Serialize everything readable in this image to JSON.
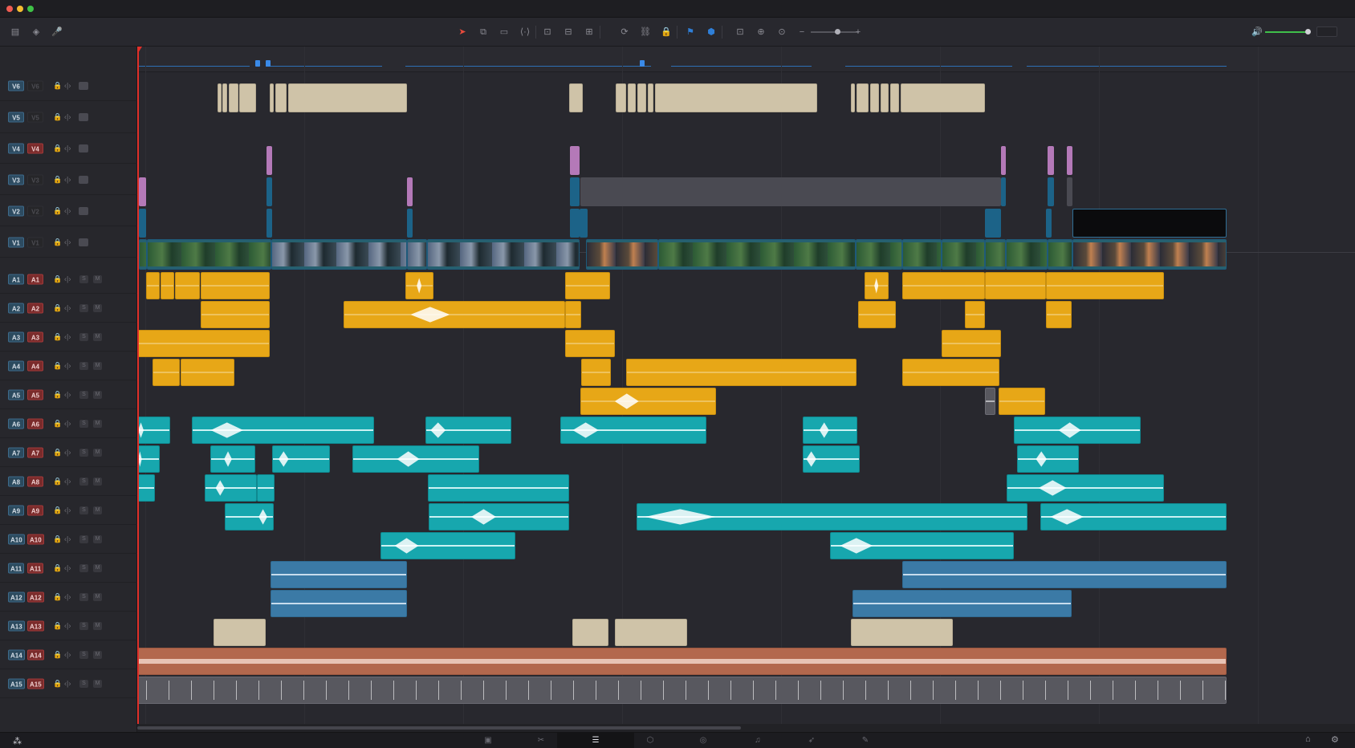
{
  "window": {
    "controls": [
      "close",
      "minimize",
      "maximize"
    ]
  },
  "toolbar": {
    "left_icons": [
      "layout-icon",
      "blade-edit-icon",
      "microphone-icon"
    ],
    "edit_tools": [
      {
        "name": "selection-tool-icon",
        "glyph": "➤",
        "active": true
      },
      {
        "name": "trim-tool-icon",
        "glyph": "⧉"
      },
      {
        "name": "blade-tool-icon",
        "glyph": "▭"
      },
      {
        "name": "dynamic-trim-icon",
        "glyph": "⟨·⟩"
      }
    ],
    "clip_tools": [
      {
        "name": "insert-clip-icon",
        "glyph": "⊡"
      },
      {
        "name": "overwrite-clip-icon",
        "glyph": "⊟"
      },
      {
        "name": "replace-clip-icon",
        "glyph": "⊞"
      }
    ],
    "link_tools": [
      {
        "name": "snapping-icon",
        "glyph": "⟳"
      },
      {
        "name": "linked-selection-icon",
        "glyph": "⛓"
      },
      {
        "name": "position-lock-icon",
        "glyph": "🔒"
      }
    ],
    "flag_tools": [
      {
        "name": "flag-icon",
        "glyph": "⚑"
      },
      {
        "name": "marker-icon",
        "glyph": "⬢"
      }
    ],
    "zoom_tools": [
      {
        "name": "full-extent-zoom-icon",
        "glyph": "⊡"
      },
      {
        "name": "detail-zoom-icon",
        "glyph": "⊕"
      },
      {
        "name": "custom-zoom-icon",
        "glyph": "⊙"
      }
    ],
    "zoom_minus": "−",
    "zoom_plus": "+",
    "zoom_level": 0.55,
    "volume_level": 0.9,
    "speaker_glyph": "🔊"
  },
  "video_tracks": [
    {
      "id": "V6",
      "dest": "V6",
      "dest_on": false
    },
    {
      "id": "V5",
      "dest": "V5",
      "dest_on": false
    },
    {
      "id": "V4",
      "dest": "V4",
      "dest_on": true
    },
    {
      "id": "V3",
      "dest": "V3",
      "dest_on": false
    },
    {
      "id": "V2",
      "dest": "V2",
      "dest_on": false
    },
    {
      "id": "V1",
      "dest": "V1",
      "dest_on": false
    }
  ],
  "audio_tracks": [
    {
      "id": "A1",
      "dest": "A1"
    },
    {
      "id": "A2",
      "dest": "A2"
    },
    {
      "id": "A3",
      "dest": "A3"
    },
    {
      "id": "A4",
      "dest": "A4"
    },
    {
      "id": "A5",
      "dest": "A5"
    },
    {
      "id": "A6",
      "dest": "A6"
    },
    {
      "id": "A7",
      "dest": "A7"
    },
    {
      "id": "A8",
      "dest": "A8"
    },
    {
      "id": "A9",
      "dest": "A9"
    },
    {
      "id": "A10",
      "dest": "A10"
    },
    {
      "id": "A11",
      "dest": "A11"
    },
    {
      "id": "A12",
      "dest": "A12"
    },
    {
      "id": "A13",
      "dest": "A13"
    },
    {
      "id": "A14",
      "dest": "A14"
    },
    {
      "id": "A15",
      "dest": "A15"
    }
  ],
  "track_header_labels": {
    "solo": "S",
    "mute": "M"
  },
  "pages": [
    {
      "name": "media-page-icon",
      "glyph": "▣"
    },
    {
      "name": "cut-page-icon",
      "glyph": "✂"
    },
    {
      "name": "edit-page-icon",
      "glyph": "☰",
      "active": true
    },
    {
      "name": "fusion-page-icon",
      "glyph": "⬡"
    },
    {
      "name": "color-page-icon",
      "glyph": "◎"
    },
    {
      "name": "fairlight-page-icon",
      "glyph": "♫"
    },
    {
      "name": "deliver-page-icon",
      "glyph": "➶"
    },
    {
      "name": "pencil-page-icon",
      "glyph": "✎"
    }
  ],
  "colors": {
    "playhead": "#e0302a",
    "dialogue_clips": "#e7a717",
    "effects_clips": "#17a7ae",
    "ambience_clips": "#3b7aa6",
    "music_clip": "#b3684d",
    "title_clips": "#cfc3a8",
    "marker": "#3a8ae8"
  }
}
